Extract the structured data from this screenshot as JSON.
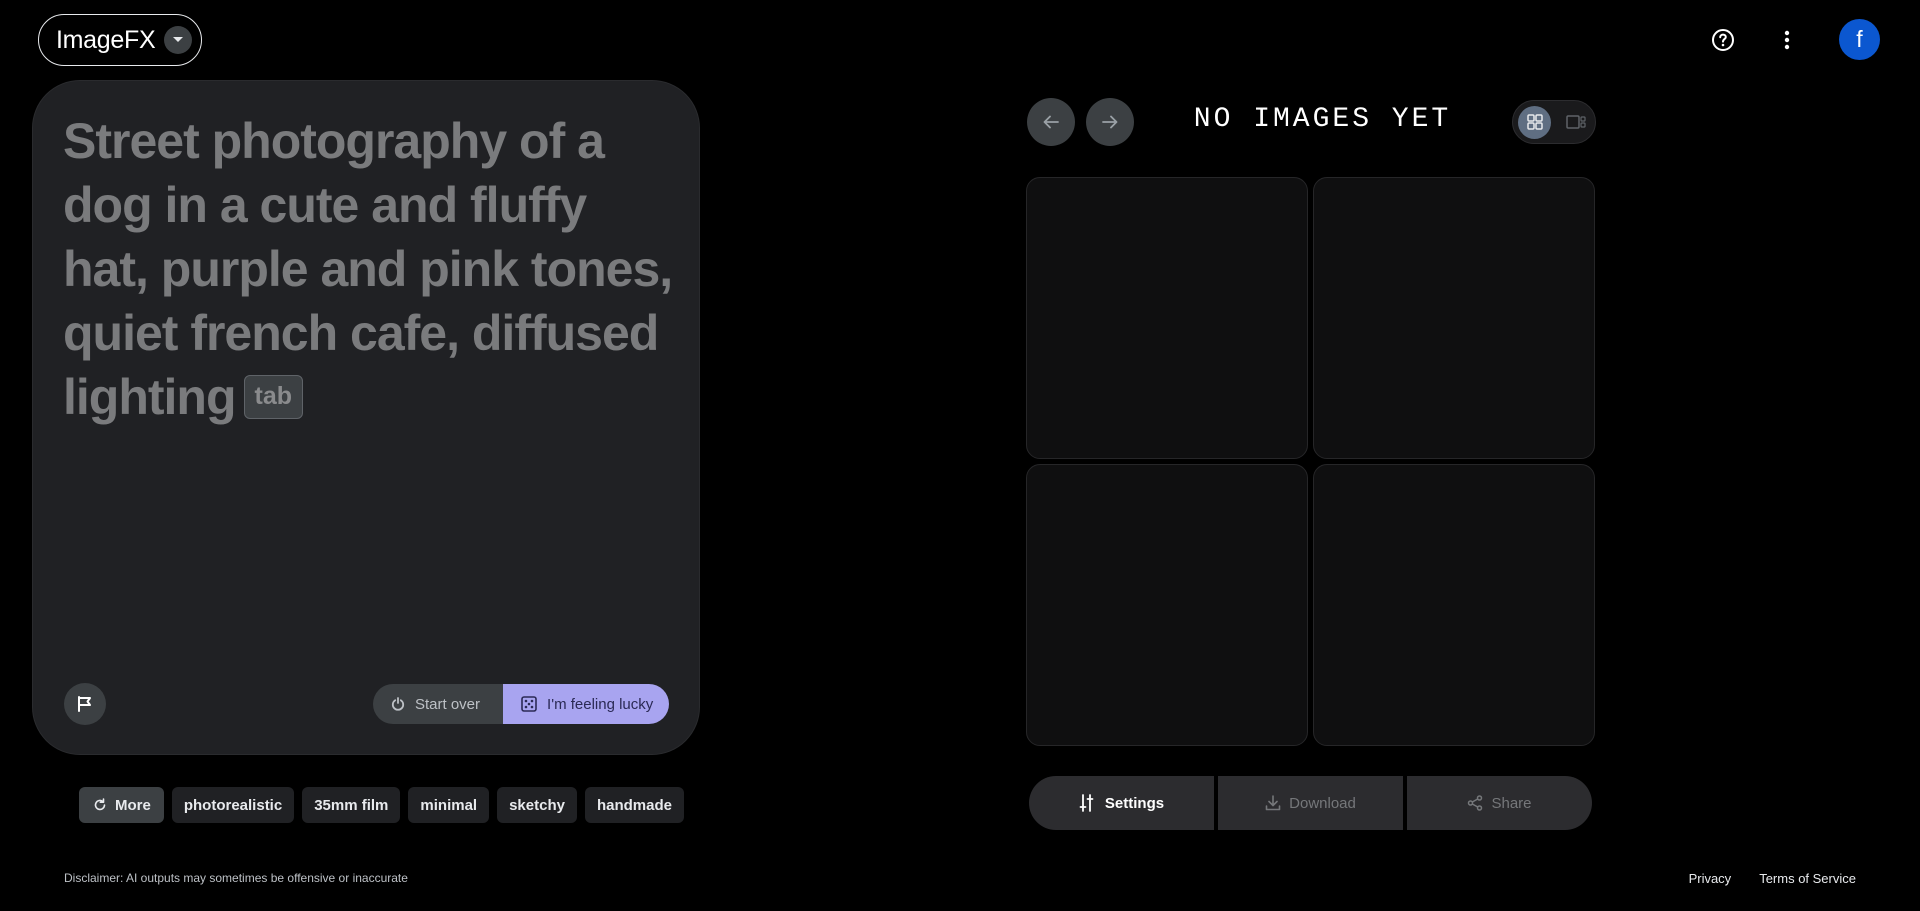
{
  "header": {
    "app_name": "ImageFX",
    "user_initial": "f"
  },
  "prompt": {
    "text": "Street photography of a dog in a cute and fluffy hat, purple and pink tones, quiet french cafe, diffused lighting",
    "tab_hint": "tab",
    "start_over_label": "Start over",
    "lucky_label": "I'm feeling lucky"
  },
  "chips": {
    "more_label": "More",
    "items": [
      "photorealistic",
      "35mm film",
      "minimal",
      "sketchy",
      "handmade"
    ]
  },
  "gallery": {
    "status": "NO IMAGES YET"
  },
  "actions": {
    "settings": "Settings",
    "download": "Download",
    "share": "Share"
  },
  "footer": {
    "disclaimer": "Disclaimer: AI outputs may sometimes be offensive or inaccurate",
    "privacy": "Privacy",
    "terms": "Terms of Service"
  },
  "colors": {
    "background": "#000000",
    "card": "#202124",
    "lucky_accent": "#a8a4f0",
    "avatar": "#0b57d0"
  }
}
